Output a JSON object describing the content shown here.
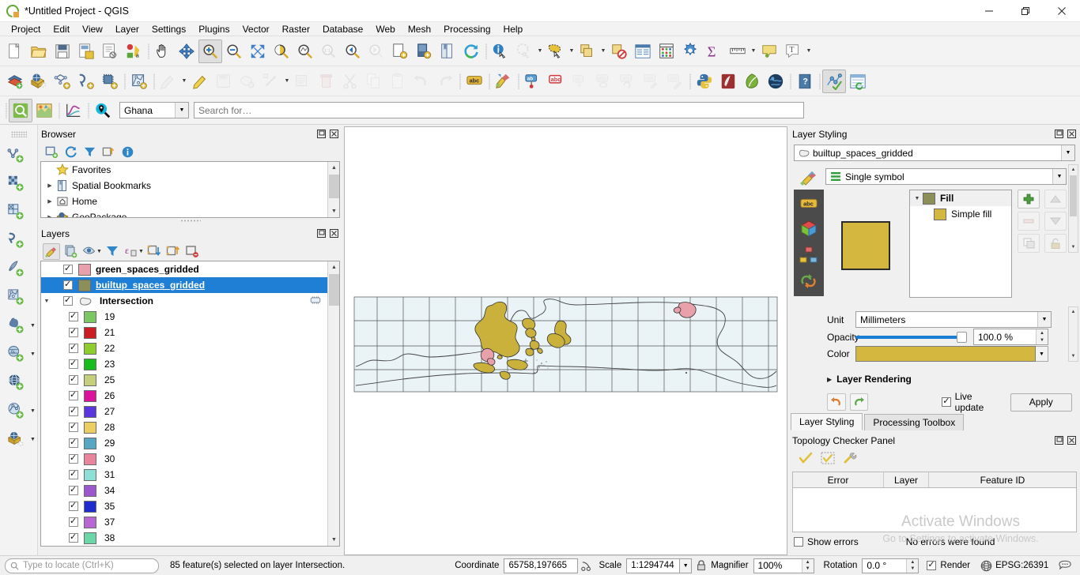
{
  "window": {
    "title": "*Untitled Project - QGIS",
    "logo_icon": "qgis-logo-icon",
    "minimize_label": "—",
    "maximize_label": "❐",
    "close_label": "✕"
  },
  "menubar": {
    "items": [
      {
        "label": "Project"
      },
      {
        "label": "Edit"
      },
      {
        "label": "View"
      },
      {
        "label": "Layer"
      },
      {
        "label": "Settings"
      },
      {
        "label": "Plugins"
      },
      {
        "label": "Vector"
      },
      {
        "label": "Raster"
      },
      {
        "label": "Database"
      },
      {
        "label": "Web"
      },
      {
        "label": "Mesh"
      },
      {
        "label": "Processing"
      },
      {
        "label": "Help"
      }
    ]
  },
  "toolbar_row1": [
    {
      "name": "new-project-icon",
      "tip": "New Project"
    },
    {
      "name": "open-project-icon",
      "tip": "Open Project"
    },
    {
      "name": "save-project-icon",
      "tip": "Save Project"
    },
    {
      "name": "save-project-as-icon",
      "tip": "Save Project As"
    },
    {
      "name": "new-print-layout-icon",
      "tip": "New Print Layout"
    },
    {
      "name": "style-manager-icon",
      "tip": "Style Manager"
    },
    {
      "name": "separator"
    },
    {
      "name": "pan-map-icon",
      "tip": "Pan Map"
    },
    {
      "name": "pan-to-selection-icon",
      "tip": "Pan Map to Selection"
    },
    {
      "name": "zoom-in-icon",
      "tip": "Zoom In",
      "active": true
    },
    {
      "name": "zoom-out-icon",
      "tip": "Zoom Out"
    },
    {
      "name": "zoom-full-icon",
      "tip": "Zoom Full"
    },
    {
      "name": "zoom-to-selection-icon",
      "tip": "Zoom to Selection"
    },
    {
      "name": "zoom-to-layer-icon",
      "tip": "Zoom to Layer"
    },
    {
      "name": "zoom-native-icon",
      "tip": "Zoom to Native Resolution",
      "disabled": true
    },
    {
      "name": "zoom-last-icon",
      "tip": "Zoom Last"
    },
    {
      "name": "zoom-next-icon",
      "tip": "Zoom Next",
      "disabled": true
    },
    {
      "name": "new-map-view-icon",
      "tip": "New Map View"
    },
    {
      "name": "new-3d-map-view-icon",
      "tip": "New 3D Map View"
    },
    {
      "name": "show-bookmarks-icon",
      "tip": "Show Bookmarks"
    },
    {
      "name": "refresh-icon",
      "tip": "Refresh"
    },
    {
      "name": "separator"
    },
    {
      "name": "identify-features-icon",
      "tip": "Identify Features"
    },
    {
      "name": "run-feature-action-icon",
      "tip": "Run Feature Action",
      "disabled": true,
      "menu": true
    },
    {
      "name": "select-features-icon",
      "tip": "Select Features by Area",
      "menu": true
    },
    {
      "name": "deselect-features-icon",
      "tip": "Select Features by Value",
      "menu": true
    },
    {
      "name": "deselect-all-icon",
      "tip": "Deselect Features from All Layers"
    },
    {
      "name": "open-attribute-table-icon",
      "tip": "Open Attribute Table"
    },
    {
      "name": "field-calculator-icon",
      "tip": "Open Field Calculator"
    },
    {
      "name": "processing-toolbox-icon",
      "tip": "Processing Toolbox"
    },
    {
      "name": "statistical-summary-icon",
      "tip": "Show Statistical Summary"
    },
    {
      "name": "measure-line-icon",
      "tip": "Measure Line",
      "menu": true
    },
    {
      "name": "map-tips-icon",
      "tip": "Show Map Tips"
    },
    {
      "name": "new-text-annotation-icon",
      "tip": "Text Annotation",
      "menu": true
    }
  ],
  "toolbar_row2": [
    {
      "name": "open-data-source-manager-icon",
      "tip": "Open Data Source Manager"
    },
    {
      "name": "add-vector-layer-icon",
      "tip": "Add Vector Layer"
    },
    {
      "name": "add-raster-layer-icon",
      "tip": "Add Raster Layer"
    },
    {
      "name": "add-delimited-text-layer-icon",
      "tip": "Add Delimited Text Layer"
    },
    {
      "name": "add-mesh-layer-icon",
      "tip": "Add Mesh Layer"
    },
    {
      "name": "separator"
    },
    {
      "name": "new-shapefile-layer-icon",
      "tip": "New Shapefile Layer"
    },
    {
      "name": "separator"
    },
    {
      "name": "current-edits-icon",
      "tip": "Current Edits",
      "disabled": true,
      "menu": true
    },
    {
      "name": "toggle-editing-icon",
      "tip": "Toggle Editing"
    },
    {
      "name": "save-layer-edits-icon",
      "tip": "Save Layer Edits",
      "disabled": true
    },
    {
      "name": "add-polygon-feature-icon",
      "tip": "Add Polygon Feature",
      "disabled": true
    },
    {
      "name": "vertex-tool-icon",
      "tip": "Vertex Tool",
      "disabled": true,
      "menu": true
    },
    {
      "name": "modify-attributes-icon",
      "tip": "Modify Attributes of Selected Features",
      "disabled": true
    },
    {
      "name": "delete-selected-icon",
      "tip": "Delete Selected",
      "disabled": true
    },
    {
      "name": "cut-features-icon",
      "tip": "Cut Features",
      "disabled": true
    },
    {
      "name": "copy-features-icon",
      "tip": "Copy Features",
      "disabled": true
    },
    {
      "name": "paste-features-icon",
      "tip": "Paste Features",
      "disabled": true
    },
    {
      "name": "undo-icon",
      "tip": "Undo",
      "disabled": true
    },
    {
      "name": "redo-icon",
      "tip": "Redo",
      "disabled": true
    },
    {
      "name": "separator"
    },
    {
      "name": "label-abc-icon",
      "tip": "Layer Labeling Options"
    },
    {
      "name": "separator"
    },
    {
      "name": "style-dock-icon",
      "tip": "Open Layer Styling Panel"
    },
    {
      "name": "separator"
    },
    {
      "name": "pin-labels-icon",
      "tip": "Pin/Unpin Labels"
    },
    {
      "name": "highlight-labels-icon",
      "tip": "Highlight Pinned Labels"
    },
    {
      "name": "move-label-icon",
      "tip": "Move a Label",
      "disabled": true
    },
    {
      "name": "show-hide-labels-icon",
      "tip": "Show/Hide Labels",
      "disabled": true
    },
    {
      "name": "rotate-label-icon",
      "tip": "Rotate a Label",
      "disabled": true
    },
    {
      "name": "change-label-icon",
      "tip": "Change Label",
      "disabled": true
    },
    {
      "name": "change-label-props-icon",
      "tip": "Change Label Properties",
      "disabled": true
    },
    {
      "name": "separator"
    },
    {
      "name": "python-console-icon",
      "tip": "Python Console"
    },
    {
      "name": "grass-icon",
      "tip": "GRASS Tools"
    },
    {
      "name": "qgis-leaf-icon",
      "tip": "Plugin"
    },
    {
      "name": "globe-plugin-icon",
      "tip": "Globe Plugin"
    },
    {
      "name": "separator"
    },
    {
      "name": "help-contents-icon",
      "tip": "Help Contents"
    },
    {
      "name": "separator"
    },
    {
      "name": "topology-checker-icon",
      "tip": "Topology Checker",
      "active": true
    },
    {
      "name": "refresh-table-icon",
      "tip": "Refresh Layer"
    }
  ],
  "toolbar_row3": {
    "buttons": [
      {
        "name": "metasearch-icon",
        "tip": "MetaSearch",
        "active": true
      },
      {
        "name": "qgis-map-plugin-icon",
        "tip": "QuickMapServices"
      },
      {
        "name": "separator"
      },
      {
        "name": "plot-tool-icon",
        "tip": "DataPlotly"
      },
      {
        "name": "separator"
      },
      {
        "name": "nominatim-locate-icon",
        "tip": "Geocoding Search"
      }
    ],
    "country_select": {
      "value": "Ghana",
      "name": "country-select"
    },
    "search_input": {
      "placeholder": "Search for…",
      "value": "",
      "name": "geocode-search-input"
    }
  },
  "vertical_toolbar": [
    {
      "name": "new-geopackage-layer-icon"
    },
    {
      "name": "new-spatialite-layer-icon"
    },
    {
      "name": "new-virtual-layer-icon"
    },
    {
      "name": "new-gpx-layer-icon"
    },
    {
      "name": "new-memory-layer-icon"
    },
    {
      "name": "add-vector-tile-layer-icon"
    },
    {
      "name": "add-postgis-layer-icon",
      "menu": true
    },
    {
      "name": "add-spatialite-layer-icon",
      "menu": true
    },
    {
      "name": "add-wms-layer-icon"
    },
    {
      "name": "add-wfs-layer-icon",
      "menu": true
    },
    {
      "name": "add-xyz-layer-icon",
      "menu": true
    }
  ],
  "browser_panel": {
    "title": "Browser",
    "float_icon": "float-panel-icon",
    "close_icon": "close-panel-icon",
    "toolbar": [
      {
        "name": "add-layer-browser-icon"
      },
      {
        "name": "refresh-browser-icon"
      },
      {
        "name": "filter-browser-icon"
      },
      {
        "name": "collapse-all-browser-icon"
      },
      {
        "name": "properties-browser-icon"
      }
    ],
    "tree": [
      {
        "label": "Favorites",
        "icon": "star-icon",
        "expandable": false
      },
      {
        "label": "Spatial Bookmarks",
        "icon": "bookmark-icon",
        "expandable": true
      },
      {
        "label": "Home",
        "icon": "home-icon",
        "expandable": true
      },
      {
        "label": "GeoPackage",
        "icon": "geopackage-icon",
        "expandable": true
      }
    ]
  },
  "layers_panel": {
    "title": "Layers",
    "float_icon": "float-panel-icon",
    "close_icon": "close-panel-icon",
    "toolbar": [
      {
        "name": "open-layer-styling-panel-icon",
        "active": true
      },
      {
        "name": "add-group-icon"
      },
      {
        "name": "manage-layer-visibility-icon",
        "menu": true
      },
      {
        "name": "filter-legend-icon"
      },
      {
        "name": "filter-legend-expression-icon",
        "menu": true
      },
      {
        "name": "expand-all-icon"
      },
      {
        "name": "collapse-all-icon"
      },
      {
        "name": "remove-layer-icon"
      }
    ],
    "layers": [
      {
        "label": "green_spaces_gridded",
        "color": "#e8a0ab",
        "checked": true,
        "bold": true,
        "indent": 0,
        "selected": false
      },
      {
        "label": "builtup_spaces_gridded",
        "color": "#8d8f58",
        "checked": true,
        "bold": true,
        "indent": 0,
        "selected": true
      },
      {
        "label": "Intersection",
        "color": null,
        "icon": "polygon-layer-icon",
        "checked": true,
        "bold": true,
        "indent": 0,
        "selected": false,
        "expanded": true,
        "has_edit_badge": true
      }
    ],
    "categories": [
      {
        "label": "19",
        "color": "#7cc764",
        "checked": true
      },
      {
        "label": "21",
        "color": "#cc1e22",
        "checked": true
      },
      {
        "label": "22",
        "color": "#8ecd2b",
        "checked": true
      },
      {
        "label": "23",
        "color": "#17bd1c",
        "checked": true
      },
      {
        "label": "25",
        "color": "#c6cf7c",
        "checked": true
      },
      {
        "label": "26",
        "color": "#dc119c",
        "checked": true
      },
      {
        "label": "27",
        "color": "#5b35de",
        "checked": true
      },
      {
        "label": "28",
        "color": "#edce63",
        "checked": true
      },
      {
        "label": "29",
        "color": "#56a6c4",
        "checked": true
      },
      {
        "label": "30",
        "color": "#e8849c",
        "checked": true
      },
      {
        "label": "31",
        "color": "#8ddfd8",
        "checked": true
      },
      {
        "label": "34",
        "color": "#9c57cc",
        "checked": true
      },
      {
        "label": "35",
        "color": "#1f2bcc",
        "checked": true
      },
      {
        "label": "37",
        "color": "#b766d4",
        "checked": true
      },
      {
        "label": "38",
        "color": "#6bd6a8",
        "checked": true
      },
      {
        "label": "",
        "color": "#2bbd4f",
        "checked": false
      }
    ]
  },
  "layer_styling": {
    "title": "Layer Styling",
    "float_icon": "float-panel-icon",
    "close_icon": "close-panel-icon",
    "layer_select": {
      "value": "builtup_spaces_gridded",
      "icon": "polygon-layer-icon"
    },
    "renderer_select": {
      "value": "Single symbol",
      "icon": "single-symbol-icon"
    },
    "side_icons": [
      {
        "name": "labels-abc-icon"
      },
      {
        "name": "3d-view-icon"
      },
      {
        "name": "diagrams-icon"
      },
      {
        "name": "history-undo-icon"
      }
    ],
    "preview_color": "#d4b73e",
    "symbol_tree": [
      {
        "label": "Fill",
        "color": "#8d8f58",
        "level": 0,
        "bold": true
      },
      {
        "label": "Simple fill",
        "color": "#d4b73e",
        "level": 1,
        "bold": false
      }
    ],
    "tree_buttons": [
      {
        "name": "add-symbol-layer-button",
        "glyph": "+",
        "disabled": false
      },
      {
        "name": "move-symbol-up-button",
        "glyph": "▲",
        "disabled": true
      },
      {
        "name": "remove-symbol-layer-button",
        "glyph": "−",
        "disabled": true
      },
      {
        "name": "move-symbol-down-button",
        "glyph": "▼",
        "disabled": true
      },
      {
        "name": "duplicate-symbol-layer-button",
        "glyph": "⧉",
        "disabled": true
      },
      {
        "name": "lock-symbol-color-button",
        "glyph": "🔓",
        "disabled": true
      }
    ],
    "unit_label": "Unit",
    "unit_value": "Millimeters",
    "opacity_label": "Opacity",
    "opacity_value": "100.0 %",
    "color_label": "Color",
    "color_value": "#d4b73e",
    "layer_rendering_label": "Layer Rendering",
    "undo_icon": "undo-style-icon",
    "redo_icon": "redo-style-icon",
    "live_update_label": "Live update",
    "live_update_checked": true,
    "apply_label": "Apply",
    "tabs": [
      {
        "label": "Layer Styling",
        "active": true
      },
      {
        "label": "Processing Toolbox",
        "active": false
      }
    ]
  },
  "topology_panel": {
    "title": "Topology Checker Panel",
    "float_icon": "float-panel-icon",
    "close_icon": "close-panel-icon",
    "toolbar": [
      {
        "name": "validate-all-icon"
      },
      {
        "name": "validate-extent-icon"
      },
      {
        "name": "configure-topology-icon"
      }
    ],
    "columns": [
      "Error",
      "Layer",
      "Feature ID"
    ],
    "rows": [],
    "show_errors_label": "Show errors",
    "show_errors_checked": false,
    "status_text": "No errors were found"
  },
  "watermark": {
    "line1": "Activate Windows",
    "line2": "Go to Settings to activate Windows."
  },
  "statusbar": {
    "locate_placeholder": "Type to locate (Ctrl+K)",
    "locate_icon": "search-icon",
    "message": "85 feature(s) selected on layer Intersection.",
    "coordinate_label": "Coordinate",
    "coordinate_value": "65758,197665",
    "coordinate_toggle_icon": "coordinate-capture-icon",
    "scale_label": "Scale",
    "scale_value": "1:1294744",
    "lock_icon": "lock-scale-icon",
    "magnifier_label": "Magnifier",
    "magnifier_value": "100%",
    "rotation_label": "Rotation",
    "rotation_value": "0.0 °",
    "render_label": "Render",
    "render_checked": true,
    "crs_label": "EPSG:26391",
    "crs_icon": "globe-crs-icon",
    "messages_icon": "messages-icon"
  },
  "map": {
    "background": "#ffffff",
    "grid_fill": "#eaf4f7",
    "grid_stroke": "#555555",
    "builtup_color": "#c9b13c",
    "green_color": "#e8a0ab",
    "outline_color": "#444444"
  }
}
